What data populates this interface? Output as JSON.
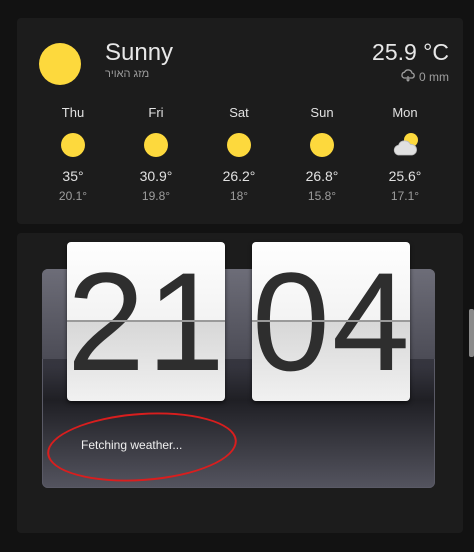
{
  "weather": {
    "condition": "Sunny",
    "location_name": "מזג האויר",
    "temperature": "25.9 °C",
    "precipitation": "0 mm",
    "forecast": [
      {
        "day": "Thu",
        "high": "35°",
        "low": "20.1°",
        "icon": "sun-icon"
      },
      {
        "day": "Fri",
        "high": "30.9°",
        "low": "19.8°",
        "icon": "sun-icon"
      },
      {
        "day": "Sat",
        "high": "26.2°",
        "low": "18°",
        "icon": "sun-icon"
      },
      {
        "day": "Sun",
        "high": "26.8°",
        "low": "15.8°",
        "icon": "sun-icon"
      },
      {
        "day": "Mon",
        "high": "25.6°",
        "low": "17.1°",
        "icon": "partly-cloudy-icon"
      }
    ]
  },
  "clock": {
    "hours": "21",
    "minutes": "04",
    "status": "Fetching weather..."
  },
  "colors": {
    "sun": "#fdd93d",
    "annotation": "#d91e1e"
  }
}
